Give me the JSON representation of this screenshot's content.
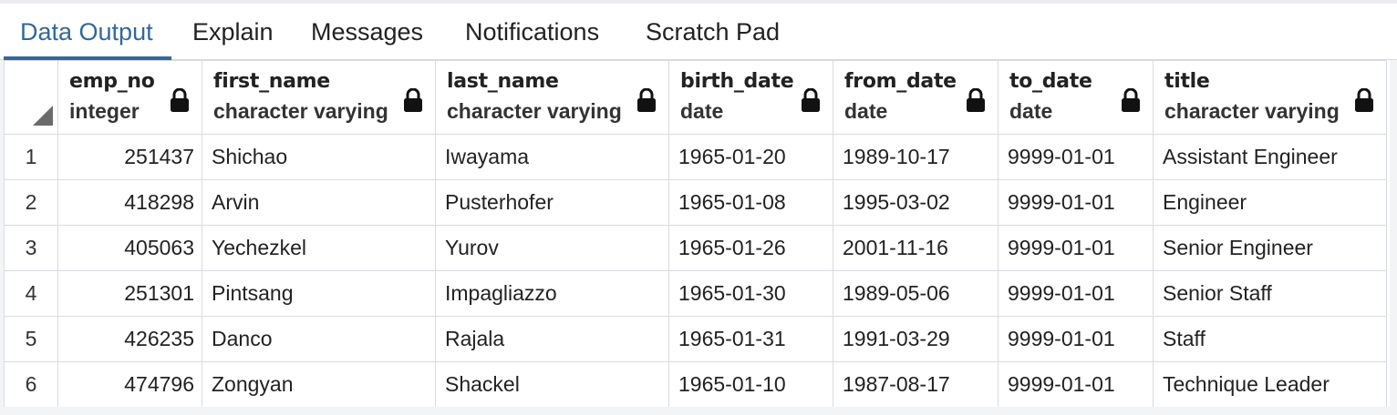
{
  "tabs": [
    {
      "label": "Data Output",
      "active": true
    },
    {
      "label": "Explain",
      "active": false
    },
    {
      "label": "Messages",
      "active": false
    },
    {
      "label": "Notifications",
      "active": false
    },
    {
      "label": "Scratch Pad",
      "active": false
    }
  ],
  "columns": [
    {
      "name": "emp_no",
      "type": "integer",
      "icon": "lock-icon"
    },
    {
      "name": "first_name",
      "type": "character varying",
      "icon": "lock-icon"
    },
    {
      "name": "last_name",
      "type": "character varying",
      "icon": "lock-icon"
    },
    {
      "name": "birth_date",
      "type": "date",
      "icon": "lock-icon"
    },
    {
      "name": "from_date",
      "type": "date",
      "icon": "lock-icon"
    },
    {
      "name": "to_date",
      "type": "date",
      "icon": "lock-icon"
    },
    {
      "name": "title",
      "type": "character varying",
      "icon": "lock-icon"
    }
  ],
  "rows": [
    {
      "row": "1",
      "emp_no": "251437",
      "first_name": "Shichao",
      "last_name": "Iwayama",
      "birth_date": "1965-01-20",
      "from_date": "1989-10-17",
      "to_date": "9999-01-01",
      "title": "Assistant Engineer"
    },
    {
      "row": "2",
      "emp_no": "418298",
      "first_name": "Arvin",
      "last_name": "Pusterhofer",
      "birth_date": "1965-01-08",
      "from_date": "1995-03-02",
      "to_date": "9999-01-01",
      "title": "Engineer"
    },
    {
      "row": "3",
      "emp_no": "405063",
      "first_name": "Yechezkel",
      "last_name": "Yurov",
      "birth_date": "1965-01-26",
      "from_date": "2001-11-16",
      "to_date": "9999-01-01",
      "title": "Senior Engineer"
    },
    {
      "row": "4",
      "emp_no": "251301",
      "first_name": "Pintsang",
      "last_name": "Impagliazzo",
      "birth_date": "1965-01-30",
      "from_date": "1989-05-06",
      "to_date": "9999-01-01",
      "title": "Senior Staff"
    },
    {
      "row": "5",
      "emp_no": "426235",
      "first_name": "Danco",
      "last_name": "Rajala",
      "birth_date": "1965-01-31",
      "from_date": "1991-03-29",
      "to_date": "9999-01-01",
      "title": "Staff"
    },
    {
      "row": "6",
      "emp_no": "474796",
      "first_name": "Zongyan",
      "last_name": "Shackel",
      "birth_date": "1965-01-10",
      "from_date": "1987-08-17",
      "to_date": "9999-01-01",
      "title": "Technique Leader"
    }
  ],
  "colors": {
    "accent": "#32689b",
    "border": "#d8dbe0"
  }
}
